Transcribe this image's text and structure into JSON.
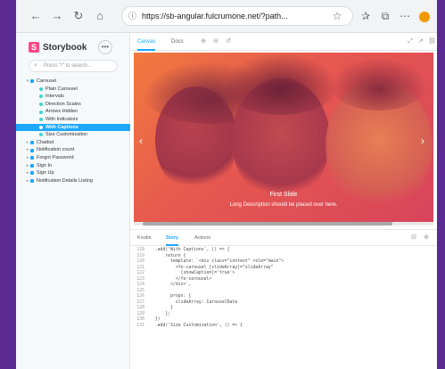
{
  "browser": {
    "url": "https://sb-angular.fulcrumone.net/?path...",
    "nav": {
      "back": "←",
      "forward": "→",
      "reload": "↻",
      "home": "⌂"
    },
    "icons": [
      "star-icon",
      "favorites-icon",
      "collections-icon",
      "extensions-icon"
    ],
    "profile_color": "#f29900"
  },
  "sidebar": {
    "brand": "Storybook",
    "search_placeholder": "Press \"/\" to search...",
    "tree": [
      {
        "label": "Carousel",
        "level": 0,
        "type": "folder",
        "expanded": true
      },
      {
        "label": "Plain Carousel",
        "level": 1,
        "type": "story"
      },
      {
        "label": "Intervals",
        "level": 1,
        "type": "story"
      },
      {
        "label": "Direction Scales",
        "level": 1,
        "type": "story"
      },
      {
        "label": "Arrows Hidden",
        "level": 1,
        "type": "story"
      },
      {
        "label": "With Indicators",
        "level": 1,
        "type": "story"
      },
      {
        "label": "With Captions",
        "level": 1,
        "type": "story",
        "selected": true
      },
      {
        "label": "Size Customization",
        "level": 1,
        "type": "story"
      },
      {
        "label": "Chatbot",
        "level": 0,
        "type": "folder"
      },
      {
        "label": "Notification count",
        "level": 0,
        "type": "folder"
      },
      {
        "label": "Forgot Password",
        "level": 0,
        "type": "folder"
      },
      {
        "label": "Sign In",
        "level": 0,
        "type": "folder"
      },
      {
        "label": "Sign Up",
        "level": 0,
        "type": "folder"
      },
      {
        "label": "Notification Details Listing",
        "level": 0,
        "type": "folder"
      }
    ]
  },
  "preview": {
    "tabs": [
      "Canvas",
      "Docs"
    ],
    "active_tab": "Canvas",
    "caption_title": "First Slide",
    "caption_text": "Long Description should be placed over here."
  },
  "addons": {
    "tabs": [
      "Knobs",
      "Story",
      "Actions"
    ],
    "active_tab": "Story",
    "code": [
      {
        "ln": "118",
        "text": "  .add('With Captions', () => {"
      },
      {
        "ln": "119",
        "text": "      return {"
      },
      {
        "ln": "120",
        "text": "        template: `<div class=\"content\" role=\"main\">"
      },
      {
        "ln": "121",
        "text": "          <fo-carousel [slideArray]=\"slideArray\""
      },
      {
        "ln": "122",
        "text": "            [showCaption]='true'>"
      },
      {
        "ln": "123",
        "text": "          </fo-carousel>"
      },
      {
        "ln": "124",
        "text": "        </div>`,"
      },
      {
        "ln": "125",
        "text": ""
      },
      {
        "ln": "126",
        "text": "        props: {"
      },
      {
        "ln": "127",
        "text": "          slideArray: CarouselData"
      },
      {
        "ln": "128",
        "text": "        }"
      },
      {
        "ln": "129",
        "text": "      };"
      },
      {
        "ln": "130",
        "text": "  })"
      },
      {
        "ln": "131",
        "text": "  .add('Size Customization', () => {"
      }
    ]
  }
}
